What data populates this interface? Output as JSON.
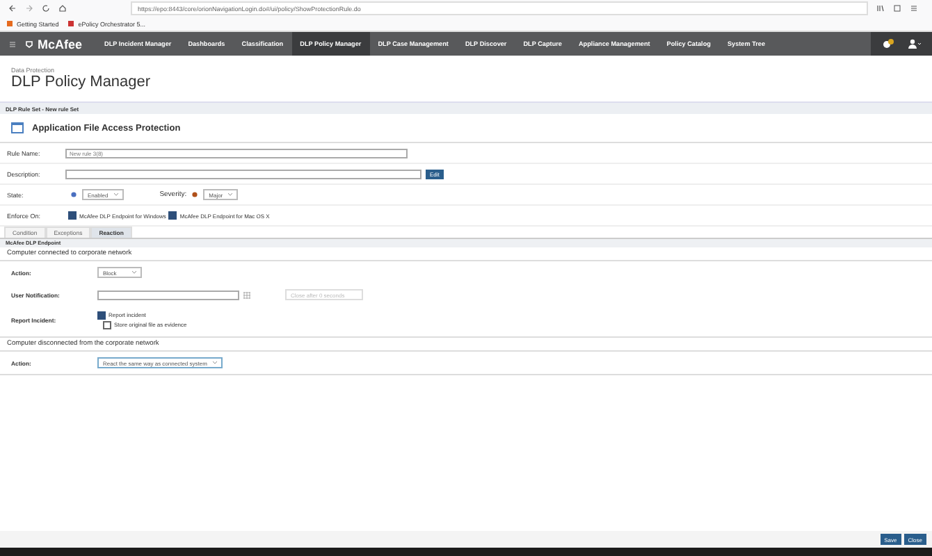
{
  "browser": {
    "url": "https://epo:8443/core/orionNavigationLogin.do#/ui/policy/ShowProtectionRule.do",
    "bookmarks": [
      "Getting Started",
      "ePolicy Orchestrator 5..."
    ]
  },
  "nav": {
    "logo": "McAfee",
    "items": [
      {
        "label": "DLP Incident Manager",
        "selected": false
      },
      {
        "label": "Dashboards",
        "selected": false
      },
      {
        "label": "Classification",
        "selected": false
      },
      {
        "label": "DLP Policy Manager",
        "selected": true
      },
      {
        "label": "DLP Case Management",
        "selected": false
      },
      {
        "label": "DLP Discover",
        "selected": false
      },
      {
        "label": "DLP Capture",
        "selected": false
      },
      {
        "label": "Appliance Management",
        "selected": false
      },
      {
        "label": "Policy Catalog",
        "selected": false
      },
      {
        "label": "System Tree",
        "selected": false
      }
    ]
  },
  "header": {
    "subtitle": "Data Protection",
    "title": "DLP Policy Manager"
  },
  "breadcrumb": "DLP Rule Set - New rule Set",
  "rule": {
    "title": "Application File Access Protection",
    "name_label": "Rule Name:",
    "name_value": "New rule 3(8)",
    "description_label": "Description:",
    "edit_button": "Edit",
    "state_label": "State:",
    "state_value": "Enabled",
    "severity_label": "Severity:",
    "severity_value": "Major",
    "enforce_label": "Enforce On:",
    "enforce": [
      {
        "label": "McAfee DLP Endpoint for Windows",
        "checked": true
      },
      {
        "label": "McAfee DLP Endpoint for Mac OS X",
        "checked": true
      }
    ]
  },
  "tabs": [
    {
      "label": "Condition",
      "selected": false
    },
    {
      "label": "Exceptions",
      "selected": false
    },
    {
      "label": "Reaction",
      "selected": true
    }
  ],
  "reaction": {
    "section": "McAfee DLP Endpoint",
    "connected_title": "Computer connected to corporate network",
    "action_label": "Action:",
    "action_value": "Block",
    "notification_label": "User Notification:",
    "close_after": "Close after 0 seconds",
    "report_label": "Report Incident:",
    "report_options": [
      {
        "label": "Report incident",
        "checked": true
      },
      {
        "label": "Store original file as evidence",
        "checked": false
      }
    ],
    "disconnected_title": "Computer disconnected from the corporate network",
    "disconnected_action_label": "Action:",
    "disconnected_action_value": "React the same way as connected system"
  },
  "footer_buttons": [
    "Save",
    "Close"
  ]
}
